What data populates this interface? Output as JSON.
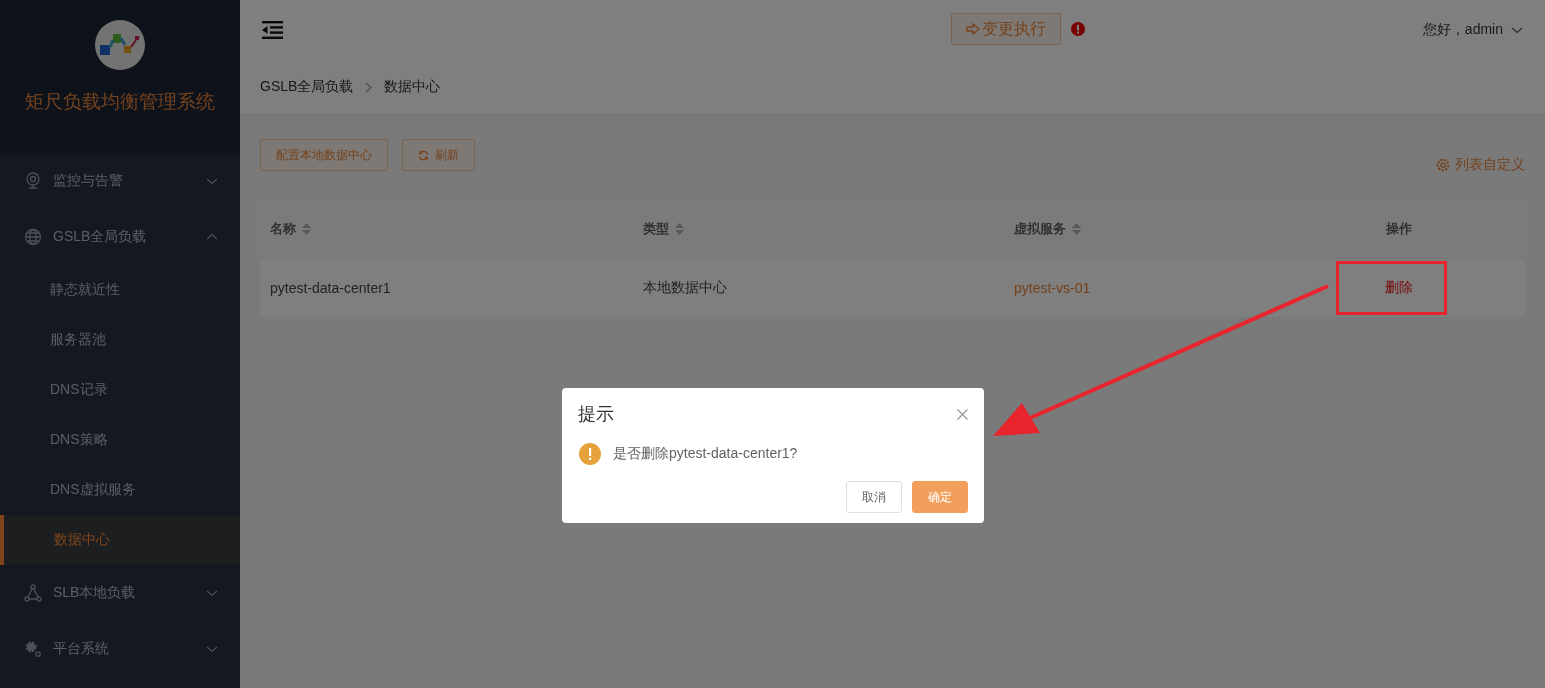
{
  "sidebar": {
    "title": "矩尺负载均衡管理系统",
    "menu": [
      {
        "label": "监控与告警",
        "expanded": false
      },
      {
        "label": "GSLB全局负载",
        "expanded": true,
        "children": [
          {
            "label": "静态就近性",
            "selected": false
          },
          {
            "label": "服务器池",
            "selected": false
          },
          {
            "label": "DNS记录",
            "selected": false
          },
          {
            "label": "DNS策略",
            "selected": false
          },
          {
            "label": "DNS虚拟服务",
            "selected": false
          },
          {
            "label": "数据中心",
            "selected": true
          }
        ]
      },
      {
        "label": "SLB本地负载",
        "expanded": false
      },
      {
        "label": "平台系统",
        "expanded": false
      }
    ]
  },
  "header": {
    "change_button": "变更执行",
    "alert": true,
    "user": "您好，admin"
  },
  "breadcrumb": [
    "GSLB全局负载",
    "数据中心"
  ],
  "toolbar": {
    "buttons": [
      {
        "kind": "plain",
        "label": "配置本地数据中心"
      },
      {
        "kind": "refresh",
        "label": "刷新"
      }
    ],
    "customize_link": "列表自定义"
  },
  "table": {
    "columns": [
      {
        "label": "名称",
        "sortable": true
      },
      {
        "label": "类型",
        "sortable": true
      },
      {
        "label": "虚拟服务",
        "sortable": true
      },
      {
        "label": "操作",
        "sortable": false
      }
    ],
    "rows": [
      {
        "name": "pytest-data-center1",
        "type": "本地数据中心",
        "virtual_service": "pytest-vs-01",
        "action": "删除"
      }
    ]
  },
  "dialog": {
    "title": "提示",
    "message": "是否删除pytest-data-center1?",
    "cancel": "取消",
    "confirm": "确定"
  }
}
